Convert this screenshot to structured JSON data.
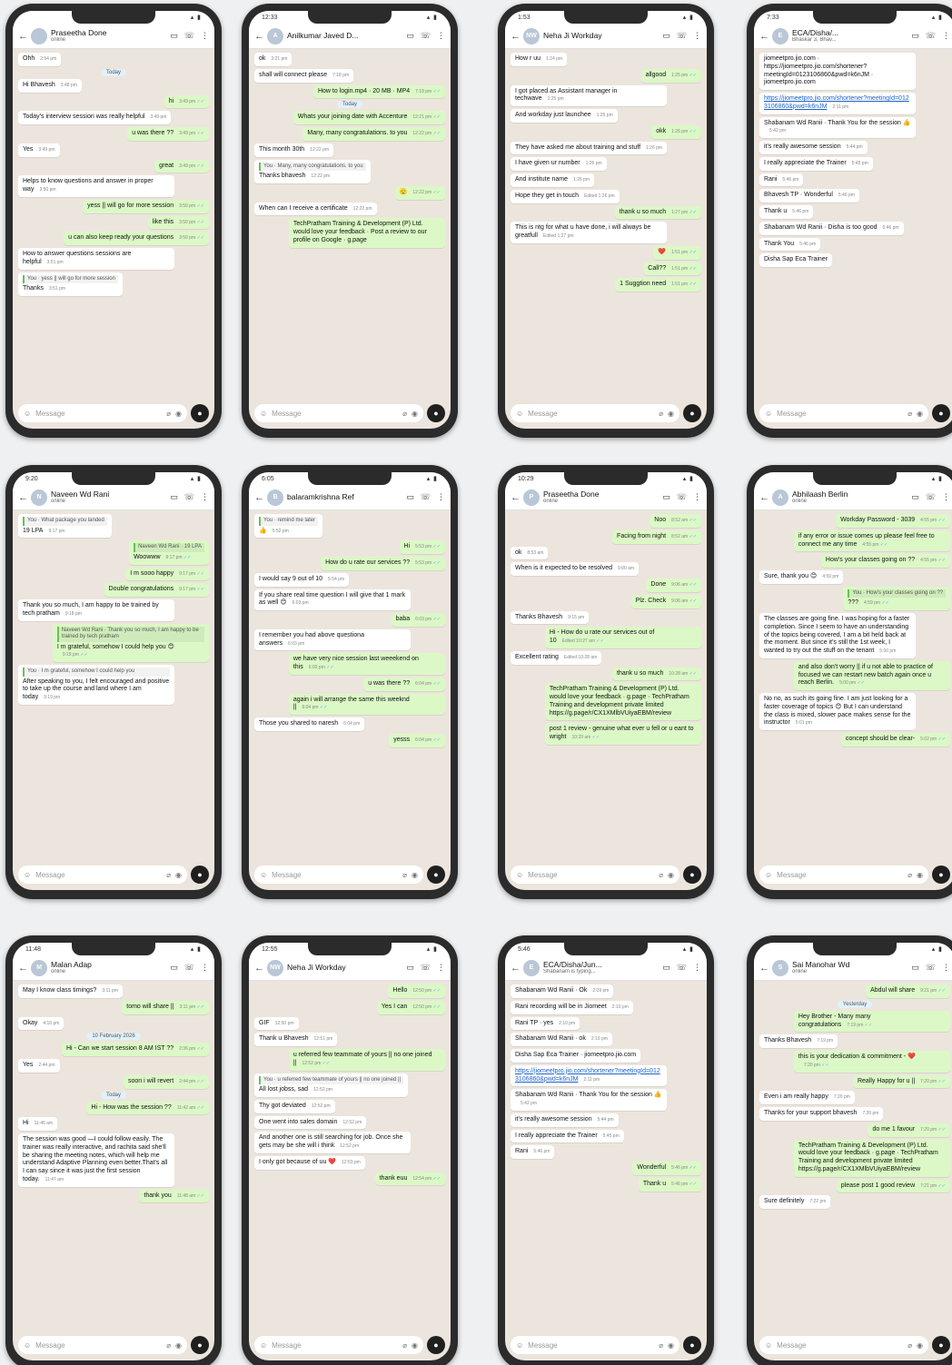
{
  "composer": {
    "placeholder": "Message"
  },
  "phones": [
    {
      "time": "",
      "name": "Praseetha Done",
      "status": "online",
      "avatar": "",
      "messages": [
        {
          "dir": "in",
          "text": "Ohh",
          "time": "2:54 pm"
        },
        {
          "dir": "date",
          "text": "Today"
        },
        {
          "dir": "in",
          "text": "Hi Bhavesh",
          "time": "3:48 pm"
        },
        {
          "dir": "out",
          "text": "hi",
          "time": "3:49 pm"
        },
        {
          "dir": "in",
          "text": "Today's interview session was really helpful",
          "time": "3:49 pm"
        },
        {
          "dir": "out",
          "text": "u was there ??",
          "time": "3:49 pm"
        },
        {
          "dir": "in",
          "text": "Yes",
          "time": "3:49 pm"
        },
        {
          "dir": "out",
          "text": "great",
          "time": "3:49 pm"
        },
        {
          "dir": "in",
          "text": "Helps to know questions and answer in proper way",
          "time": "3:50 pm"
        },
        {
          "dir": "out",
          "text": "yess || will go for more session",
          "time": "3:50 pm"
        },
        {
          "dir": "out",
          "text": "like this",
          "time": "3:50 pm"
        },
        {
          "dir": "out",
          "text": "u can also keep ready your questions",
          "time": "3:50 pm"
        },
        {
          "dir": "in",
          "text": "How to answer questions sessions are helpful",
          "time": "3:51 pm"
        },
        {
          "dir": "in",
          "quote": "You · yess || will go for more session",
          "text": "Thanks",
          "time": "3:51 pm"
        }
      ]
    },
    {
      "time": "12:33",
      "name": "Anilkumar Javed D...",
      "status": "",
      "avatar": "A",
      "messages": [
        {
          "dir": "in",
          "text": "ok",
          "time": "3:21 pm"
        },
        {
          "dir": "in",
          "text": "shall will connect please",
          "time": "7:18 pm"
        },
        {
          "dir": "out",
          "text": "How to login.mp4 · 20 MB · MP4",
          "time": "7:18 pm"
        },
        {
          "dir": "date",
          "text": "Today"
        },
        {
          "dir": "out",
          "text": "Whats your joining date with Accenture",
          "time": "12:21 pm"
        },
        {
          "dir": "out",
          "text": "Many, many congratulations. to you",
          "time": "12:22 pm"
        },
        {
          "dir": "in",
          "text": "This month 30th",
          "time": "12:22 pm"
        },
        {
          "dir": "in",
          "quote": "You · Many, many congratulations. to you",
          "text": "Thanks bhavesh",
          "time": "12:22 pm"
        },
        {
          "dir": "out",
          "text": "🫡",
          "time": "12:22 pm"
        },
        {
          "dir": "in",
          "text": "When can I receive a certificate",
          "time": "12:22 pm"
        },
        {
          "dir": "out",
          "text": "TechPratham Training & Development (P) Ltd. would love your feedback · Post a review to our profile on Google · g.page",
          "time": ""
        }
      ]
    },
    {
      "time": "1:53",
      "name": "Neha Ji Workday",
      "status": "",
      "avatar": "NW",
      "messages": [
        {
          "dir": "in",
          "text": "How r uu",
          "time": "1:24 pm"
        },
        {
          "dir": "out",
          "text": "allgood",
          "time": "1:25 pm"
        },
        {
          "dir": "in",
          "text": "I got placed as Assistant manager in techwave",
          "time": "1:25 pm"
        },
        {
          "dir": "in",
          "text": "And workday just launchee",
          "time": "1:25 pm"
        },
        {
          "dir": "out",
          "text": "okk",
          "time": "1:26 pm"
        },
        {
          "dir": "in",
          "text": "They have asked me about training and stuff",
          "time": "1:26 pm"
        },
        {
          "dir": "in",
          "text": "I have given ur number",
          "time": "1:26 pm"
        },
        {
          "dir": "in",
          "text": "And institute name",
          "time": "1:26 pm"
        },
        {
          "dir": "in",
          "text": "Hope they get in touch",
          "time": "Edited 1:26 pm"
        },
        {
          "dir": "out",
          "text": "thank u so much",
          "time": "1:27 pm"
        },
        {
          "dir": "in",
          "text": "This is ntg for what u have done, i will always be greatfull",
          "time": "Edited 1:27 pm"
        },
        {
          "dir": "out",
          "text": "❤️",
          "time": "1:51 pm"
        },
        {
          "dir": "out",
          "text": "Call??",
          "time": "1:51 pm"
        },
        {
          "dir": "out",
          "text": "1 Suggtion need",
          "time": "1:51 pm"
        }
      ]
    },
    {
      "time": "7:33",
      "name": "ECA/Disha/...",
      "status": "Bhaskar 3, Bhav...",
      "avatar": "E",
      "messages": [
        {
          "dir": "in",
          "text": "jiomeetpro.jio.com · https://jiomeetpro.jio.com/shortener?meetingId=0123106860&pwd=k6nJM · jiomeetpro.jio.com",
          "time": ""
        },
        {
          "dir": "in",
          "link": true,
          "text": "https://jiomeetpro.jio.com/shortener?meetingId=0123106860&pwd=k6nJM",
          "time": "2:11 pm"
        },
        {
          "dir": "in",
          "text": "Shabanam Wd Ranii · Thank You for the session 👍",
          "time": "5:42 pm"
        },
        {
          "dir": "in",
          "text": "it's really awesome session",
          "time": "5:44 pm"
        },
        {
          "dir": "in",
          "text": "I really appreciate the Trainer",
          "time": "5:45 pm"
        },
        {
          "dir": "in",
          "text": "Rani",
          "time": "5:46 pm"
        },
        {
          "dir": "in",
          "text": "Bhavesh TP · Wonderful",
          "time": "5:46 pm"
        },
        {
          "dir": "in",
          "text": "Thank u",
          "time": "5:46 pm"
        },
        {
          "dir": "in",
          "text": "Shabanam Wd Ranii · Disha is too good",
          "time": "5:46 pm"
        },
        {
          "dir": "in",
          "text": "Thank You",
          "time": "5:46 pm"
        },
        {
          "dir": "in",
          "text": "Disha Sap Eca Trainer",
          "time": ""
        }
      ]
    },
    {
      "time": "9:20",
      "name": "Naveen Wd Rani",
      "status": "online",
      "avatar": "N",
      "messages": [
        {
          "dir": "in",
          "quote": "You · What package you landed",
          "text": "19 LPA",
          "time": "9:17 pm"
        },
        {
          "dir": "out",
          "quote": "Naveen Wd Rani · 19 LPA",
          "text": "Woowww",
          "time": "9:17 pm"
        },
        {
          "dir": "out",
          "text": "I m sooo happy",
          "time": "9:17 pm"
        },
        {
          "dir": "out",
          "text": "Double congratulations",
          "time": "9:17 pm"
        },
        {
          "dir": "in",
          "text": "Thank you so much, I am happy to be trained by tech pratham",
          "time": "9:18 pm"
        },
        {
          "dir": "out",
          "quote": "Naveen Wd Rani · Thank you so much, I am happy to be trained by tech pratham",
          "text": "I m grateful, somehow I could help you 😊",
          "time": "9:19 pm"
        },
        {
          "dir": "in",
          "quote": "You · I m grateful, somehow I could help you",
          "text": "After speaking to you, I felt encouraged and positive to take up the course and land where I am today",
          "time": "9:19 pm"
        }
      ]
    },
    {
      "time": "6:05",
      "name": "balaramkrishna Ref",
      "status": "",
      "avatar": "B",
      "messages": [
        {
          "dir": "in",
          "quote": "You · remind me later",
          "text": "👍",
          "time": "5:52 pm"
        },
        {
          "dir": "out",
          "text": "Hi",
          "time": "5:53 pm"
        },
        {
          "dir": "out",
          "text": "How do u rate our services ??",
          "time": "5:53 pm"
        },
        {
          "dir": "in",
          "text": "I would say 9 out of 10",
          "time": "5:54 pm"
        },
        {
          "dir": "in",
          "text": "If you share real time question I will give that 1 mark as well 😊",
          "time": "6:03 pm"
        },
        {
          "dir": "out",
          "text": "baba",
          "time": "6:03 pm"
        },
        {
          "dir": "in",
          "text": "I remember you had above questiona answers",
          "time": "6:03 pm"
        },
        {
          "dir": "out",
          "text": "we have very nice session last weeekend on this",
          "time": "6:03 pm"
        },
        {
          "dir": "out",
          "text": "u was there ??",
          "time": "6:04 pm"
        },
        {
          "dir": "out",
          "text": "again i will arrange the same this weeknd ||",
          "time": "6:04 pm"
        },
        {
          "dir": "in",
          "text": "Those you shared to naresh",
          "time": "6:04 pm"
        },
        {
          "dir": "out",
          "text": "yesss",
          "time": "6:04 pm"
        }
      ]
    },
    {
      "time": "10:29",
      "name": "Praseetha Done",
      "status": "online",
      "avatar": "P",
      "messages": [
        {
          "dir": "out",
          "text": "Noo",
          "time": "8:52 am"
        },
        {
          "dir": "out",
          "text": "Facing from night",
          "time": "8:52 am"
        },
        {
          "dir": "in",
          "text": "ok",
          "time": "8:53 am"
        },
        {
          "dir": "in",
          "text": "When is it expected to be resolved",
          "time": "9:00 am"
        },
        {
          "dir": "out",
          "text": "Done",
          "time": "9:06 am"
        },
        {
          "dir": "out",
          "text": "Plz. Check",
          "time": "9:06 am"
        },
        {
          "dir": "in",
          "text": "Thanks Bhavesh",
          "time": "9:15 am"
        },
        {
          "dir": "out",
          "text": "Hi - How do u rate our services out of 10",
          "time": "Edited 10:27 am"
        },
        {
          "dir": "in",
          "text": "Excellent rating",
          "time": "Edited 10:28 am"
        },
        {
          "dir": "out",
          "text": "thank u so much",
          "time": "10:28 am"
        },
        {
          "dir": "out",
          "text": "TechPratham Training & Development (P) Ltd. would love your feedback · g.page · TechPratham Training and development private limited https://g.page/r/CX1XMlbVUiyaEBM/review",
          "time": ""
        },
        {
          "dir": "out",
          "text": "post 1 review - genuine what ever u fell or u eant to wright",
          "time": "10:29 am"
        }
      ]
    },
    {
      "time": "",
      "name": "Abhilaash Berlin",
      "status": "online",
      "avatar": "A",
      "messages": [
        {
          "dir": "out",
          "text": "Workday Password - 3039",
          "time": "4:55 pm"
        },
        {
          "dir": "out",
          "text": "if any error or issue comes up please feel free to connect me any time",
          "time": "4:55 pm"
        },
        {
          "dir": "out",
          "text": "How's your classes going on ??",
          "time": "4:55 pm"
        },
        {
          "dir": "in",
          "text": "Sure, thank you 😊",
          "time": "4:59 pm"
        },
        {
          "dir": "out",
          "quote": "You · How's your classes going on ??",
          "text": "???",
          "time": "4:59 pm"
        },
        {
          "dir": "in",
          "text": "The classes are going fine. I was hoping for a faster completion. Since I seem to have an understanding of the topics being covered, I am a bit held back at the moment. But since it's still the 1st week, I wanted to try out the stuff on the tenant",
          "time": "5:00 pm"
        },
        {
          "dir": "out",
          "text": "and also don't worry || if u not able to practice of focused we can restart new batch again once u reach Berlin.",
          "time": "5:00 pm"
        },
        {
          "dir": "in",
          "text": "No no, as such its going fine. I am just looking for a faster coverage of topics 😊 But I can understand the class is mixed, slower pace makes sense for the instructor",
          "time": "5:01 pm"
        },
        {
          "dir": "out",
          "text": "concept should be clear-",
          "time": "5:02 pm"
        }
      ]
    },
    {
      "time": "11:48",
      "name": "Malan Adap",
      "status": "online",
      "avatar": "M",
      "messages": [
        {
          "dir": "in",
          "text": "May I know class timings?",
          "time": "3:11 pm"
        },
        {
          "dir": "out",
          "text": "tomo will share ||",
          "time": "3:11 pm"
        },
        {
          "dir": "in",
          "text": "Okay",
          "time": "4:10 pm"
        },
        {
          "dir": "date",
          "text": "10 February 2026"
        },
        {
          "dir": "out",
          "text": "Hi - Can we start session 8 AM IST ??",
          "time": "2:36 pm"
        },
        {
          "dir": "in",
          "text": "Yes",
          "time": "2:44 pm"
        },
        {
          "dir": "out",
          "text": "soon i will revert",
          "time": "2:44 pm"
        },
        {
          "dir": "date",
          "text": "Today"
        },
        {
          "dir": "out",
          "text": "Hi - How was the session ??",
          "time": "11:42 am"
        },
        {
          "dir": "in",
          "text": "Hi",
          "time": "11:46 am"
        },
        {
          "dir": "in",
          "text": "The session was good —I could follow easily. The trainer was really interactive, and rachita said she'll be sharing the meeting notes, which will help me understand Adaptive Planning even better.That's all I can say since it was just the first session today.",
          "time": "11:47 am"
        },
        {
          "dir": "out",
          "text": "thank you",
          "time": "11:48 am"
        }
      ]
    },
    {
      "time": "12:55",
      "name": "Neha Ji Workday",
      "status": "",
      "avatar": "NW",
      "messages": [
        {
          "dir": "out",
          "text": "Hello",
          "time": "12:50 pm"
        },
        {
          "dir": "out",
          "text": "Yes I can",
          "time": "12:50 pm"
        },
        {
          "dir": "in",
          "text": "GIF",
          "time": "12:50 pm"
        },
        {
          "dir": "in",
          "text": "Thank u Bhavesh",
          "time": "12:51 pm"
        },
        {
          "dir": "out",
          "text": "u referred few teammate of yours || no one joined ||",
          "time": "12:52 pm"
        },
        {
          "dir": "in",
          "quote": "You · u referred few teammate of yours || no one joined ||",
          "text": "All lost jobss, sad",
          "time": "12:52 pm"
        },
        {
          "dir": "in",
          "text": "Thy got deviated",
          "time": "12:52 pm"
        },
        {
          "dir": "in",
          "text": "One went into sales domain",
          "time": "12:52 pm"
        },
        {
          "dir": "in",
          "text": "And another one is still searching for job. Once she gets may be she will i think",
          "time": "12:52 pm"
        },
        {
          "dir": "in",
          "text": "I only got because of uu ❤️",
          "time": "12:53 pm"
        },
        {
          "dir": "out",
          "text": "thank euu",
          "time": "12:54 pm"
        }
      ]
    },
    {
      "time": "5:46",
      "name": "ECA/Disha/Jun...",
      "status": "Shabanam is typing...",
      "avatar": "E",
      "messages": [
        {
          "dir": "in",
          "text": "Shabanam Wd Ranii · Ok",
          "time": "2:09 pm"
        },
        {
          "dir": "in",
          "text": "Rani recording will be in Jiomeet",
          "time": "2:10 pm"
        },
        {
          "dir": "in",
          "text": "Rani TP · yes",
          "time": "2:10 pm"
        },
        {
          "dir": "in",
          "text": "Shabanam Wd Ranii · ok",
          "time": "2:10 pm"
        },
        {
          "dir": "in",
          "text": "Disha Sap Eca Trainer · jiomeetpro.jio.com",
          "time": ""
        },
        {
          "dir": "in",
          "link": true,
          "text": "https://jiomeetpro.jio.com/shortener?meetingId=0123106860&pwd=k6nJM",
          "time": "2:11 pm"
        },
        {
          "dir": "in",
          "text": "Shabanam Wd Ranii · Thank You for the session 👍",
          "time": "5:42 pm"
        },
        {
          "dir": "in",
          "text": "it's really awesome session",
          "time": "5:44 pm"
        },
        {
          "dir": "in",
          "text": "I really appreciate the Trainer",
          "time": "5:45 pm"
        },
        {
          "dir": "in",
          "text": "Rani",
          "time": "5:46 pm"
        },
        {
          "dir": "out",
          "text": "Wonderful",
          "time": "5:46 pm"
        },
        {
          "dir": "out",
          "text": "Thank u",
          "time": "5:46 pm"
        }
      ]
    },
    {
      "time": "",
      "name": "Sai Manohar Wd",
      "status": "online",
      "avatar": "S",
      "messages": [
        {
          "dir": "out",
          "text": "Abdul will share",
          "time": "9:21 pm"
        },
        {
          "dir": "date",
          "text": "Yesterday"
        },
        {
          "dir": "out",
          "text": "Hey Brother - Many many congratulations",
          "time": "7:19 pm"
        },
        {
          "dir": "in",
          "text": "Thanks Bhavesh",
          "time": "7:19 pm"
        },
        {
          "dir": "out",
          "text": "this is your dedication & commitment - ❤️",
          "time": "7:20 pm"
        },
        {
          "dir": "out",
          "text": "Really Happy for u ||",
          "time": "7:20 pm"
        },
        {
          "dir": "in",
          "text": "Even i am really happy",
          "time": "7:20 pm"
        },
        {
          "dir": "in",
          "text": "Thanks for your support bhavesh",
          "time": "7:20 pm"
        },
        {
          "dir": "out",
          "text": "do me 1 favour",
          "time": "7:20 pm"
        },
        {
          "dir": "out",
          "text": "TechPratham Training & Development (P) Ltd. would love your feedback · g.page · TechPratham Training and development private limited https://g.page/r/CX1XMlbVUiyaEBM/review",
          "time": ""
        },
        {
          "dir": "out",
          "text": "please post 1 good review",
          "time": "7:21 pm"
        },
        {
          "dir": "in",
          "text": "Sure definitely",
          "time": "7:22 pm"
        }
      ]
    }
  ]
}
